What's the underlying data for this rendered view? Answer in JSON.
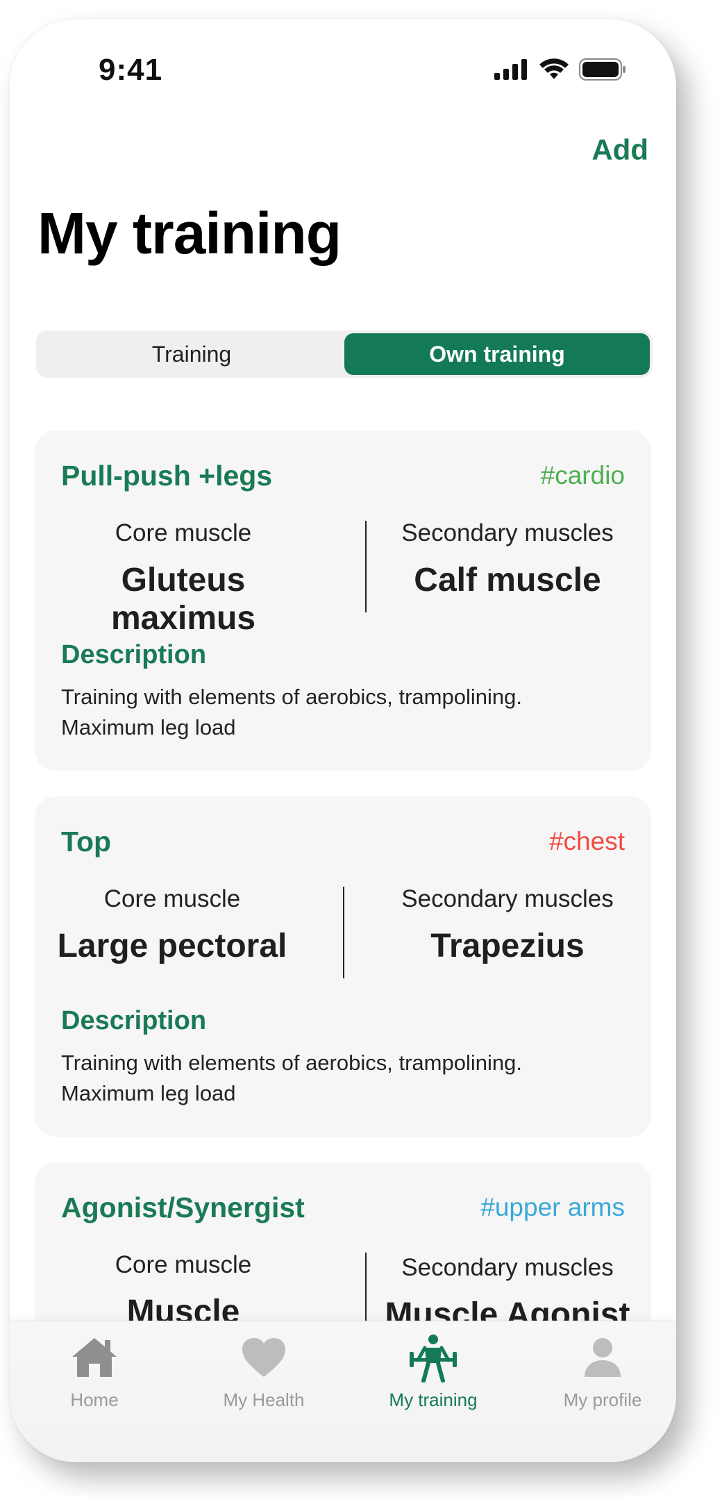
{
  "status_bar": {
    "time": "9:41"
  },
  "header": {
    "add_label": "Add",
    "title": "My training"
  },
  "segmented": {
    "options": [
      "Training",
      "Own training"
    ],
    "selected": "Own training"
  },
  "cards": [
    {
      "title": "Pull-push +legs",
      "tag": "#cardio",
      "tag_color": "#4caf50",
      "core_label": "Core muscle",
      "core_value": "Gluteus maximus",
      "secondary_label": "Secondary muscles",
      "secondary_value": "Calf muscle",
      "description_title": "Description",
      "description": "Training with elements of aerobics, trampolining. Maximum leg load"
    },
    {
      "title": "Top",
      "tag": "#chest",
      "tag_color": "#f04a40",
      "core_label": "Core muscle",
      "core_value": "Large pectoral",
      "secondary_label": "Secondary muscles",
      "secondary_value": "Trapezius",
      "description_title": "Description",
      "description": "Training with elements of aerobics, trampolining. Maximum leg load"
    },
    {
      "title": "Agonist/Synergist",
      "tag": "#upper arms",
      "tag_color": "#3aa8d8",
      "core_label": "Core muscle",
      "core_value": "Muscle Synergist",
      "secondary_label": "Secondary muscles",
      "secondary_value": "Muscle Agonist"
    }
  ],
  "tabbar": {
    "items": [
      {
        "label": "Home",
        "icon": "home-icon"
      },
      {
        "label": "My Health",
        "icon": "heart-icon"
      },
      {
        "label": "My training",
        "icon": "weightlifter-icon"
      },
      {
        "label": "My profile",
        "icon": "person-icon"
      }
    ],
    "active": "My training"
  },
  "colors": {
    "accent": "#137a55",
    "title_green": "#1a7a55",
    "inactive": "#9a9a9a"
  }
}
